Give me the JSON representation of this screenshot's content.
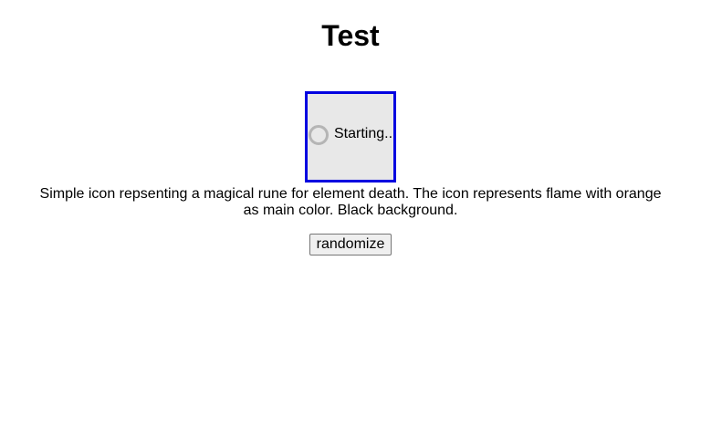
{
  "page": {
    "title": "Test"
  },
  "preview": {
    "status_text": "Starting..",
    "spinner_icon": "loading-spinner-icon",
    "border_color": "#0000e0",
    "background_color": "#e8e8e8"
  },
  "description": "Simple icon repsenting a magical rune for element death. The icon represents flame with orange as main color. Black background.",
  "controls": {
    "randomize_label": "randomize"
  }
}
